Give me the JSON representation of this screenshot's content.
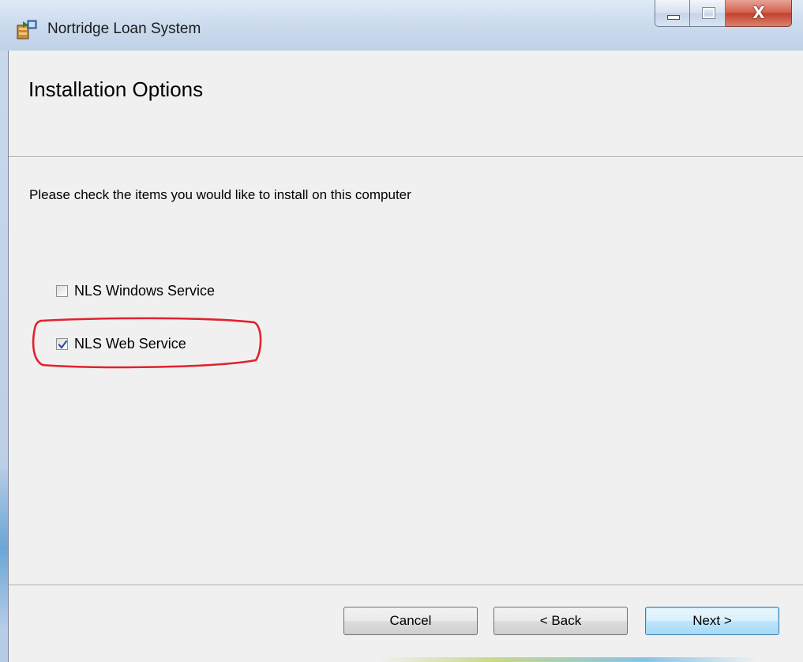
{
  "window": {
    "title": "Nortridge Loan System",
    "caption_buttons": [
      "minimize-icon",
      "maximize-icon",
      "close-icon"
    ],
    "close_glyph": "X"
  },
  "page": {
    "heading": "Installation Options",
    "instruction": "Please check the items you would like to install on this computer"
  },
  "options": [
    {
      "label": "NLS Windows Service",
      "checked": false
    },
    {
      "label": "NLS Web Service",
      "checked": true,
      "highlighted": true
    }
  ],
  "buttons": {
    "cancel": "Cancel",
    "back": "< Back",
    "next": "Next >"
  },
  "colors": {
    "highlight_annotation": "#e0232d",
    "client_background": "#f0f0f0",
    "checkmark": "#2a4f9c"
  }
}
